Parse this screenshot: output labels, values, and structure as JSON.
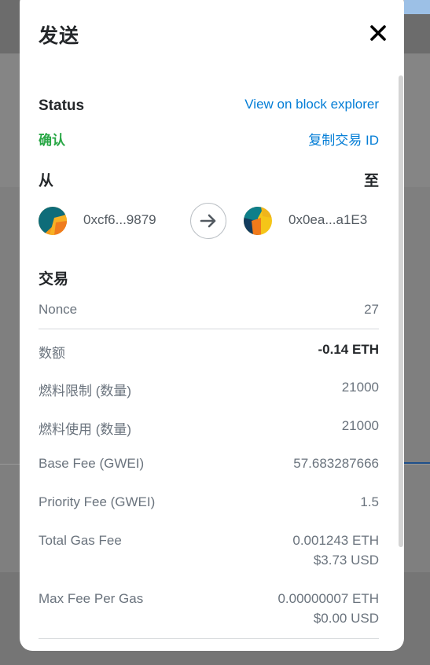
{
  "modal": {
    "title": "发送",
    "close_icon": "close-icon"
  },
  "status": {
    "label": "Status",
    "value": "确认",
    "explorer_link": "View on block explorer",
    "copy_link": "复制交易 ID"
  },
  "parties": {
    "from_label": "从",
    "to_label": "至",
    "from_address": "0xcf6...9879",
    "to_address": "0x0ea...a1E3",
    "arrow_icon": "arrow-right-icon"
  },
  "transaction": {
    "title": "交易",
    "rows": [
      {
        "label": "Nonce",
        "value": "27"
      },
      {
        "label": "数额",
        "value": "-0.14 ETH"
      },
      {
        "label": "燃料限制 (数量)",
        "value": "21000"
      },
      {
        "label": "燃料使用 (数量)",
        "value": "21000"
      },
      {
        "label": "Base Fee (GWEI)",
        "value": "57.683287666"
      },
      {
        "label": "Priority Fee (GWEI)",
        "value": "1.5"
      },
      {
        "label": "Total Gas Fee",
        "value": "0.001243 ETH",
        "value2": "$3.73 USD"
      },
      {
        "label": "Max Fee Per Gas",
        "value": "0.00000007 ETH",
        "value2": "$0.00 USD"
      }
    ]
  },
  "colors": {
    "link": "#037dd6",
    "confirmed": "#28a745",
    "overlay": "#7f7f7f"
  }
}
